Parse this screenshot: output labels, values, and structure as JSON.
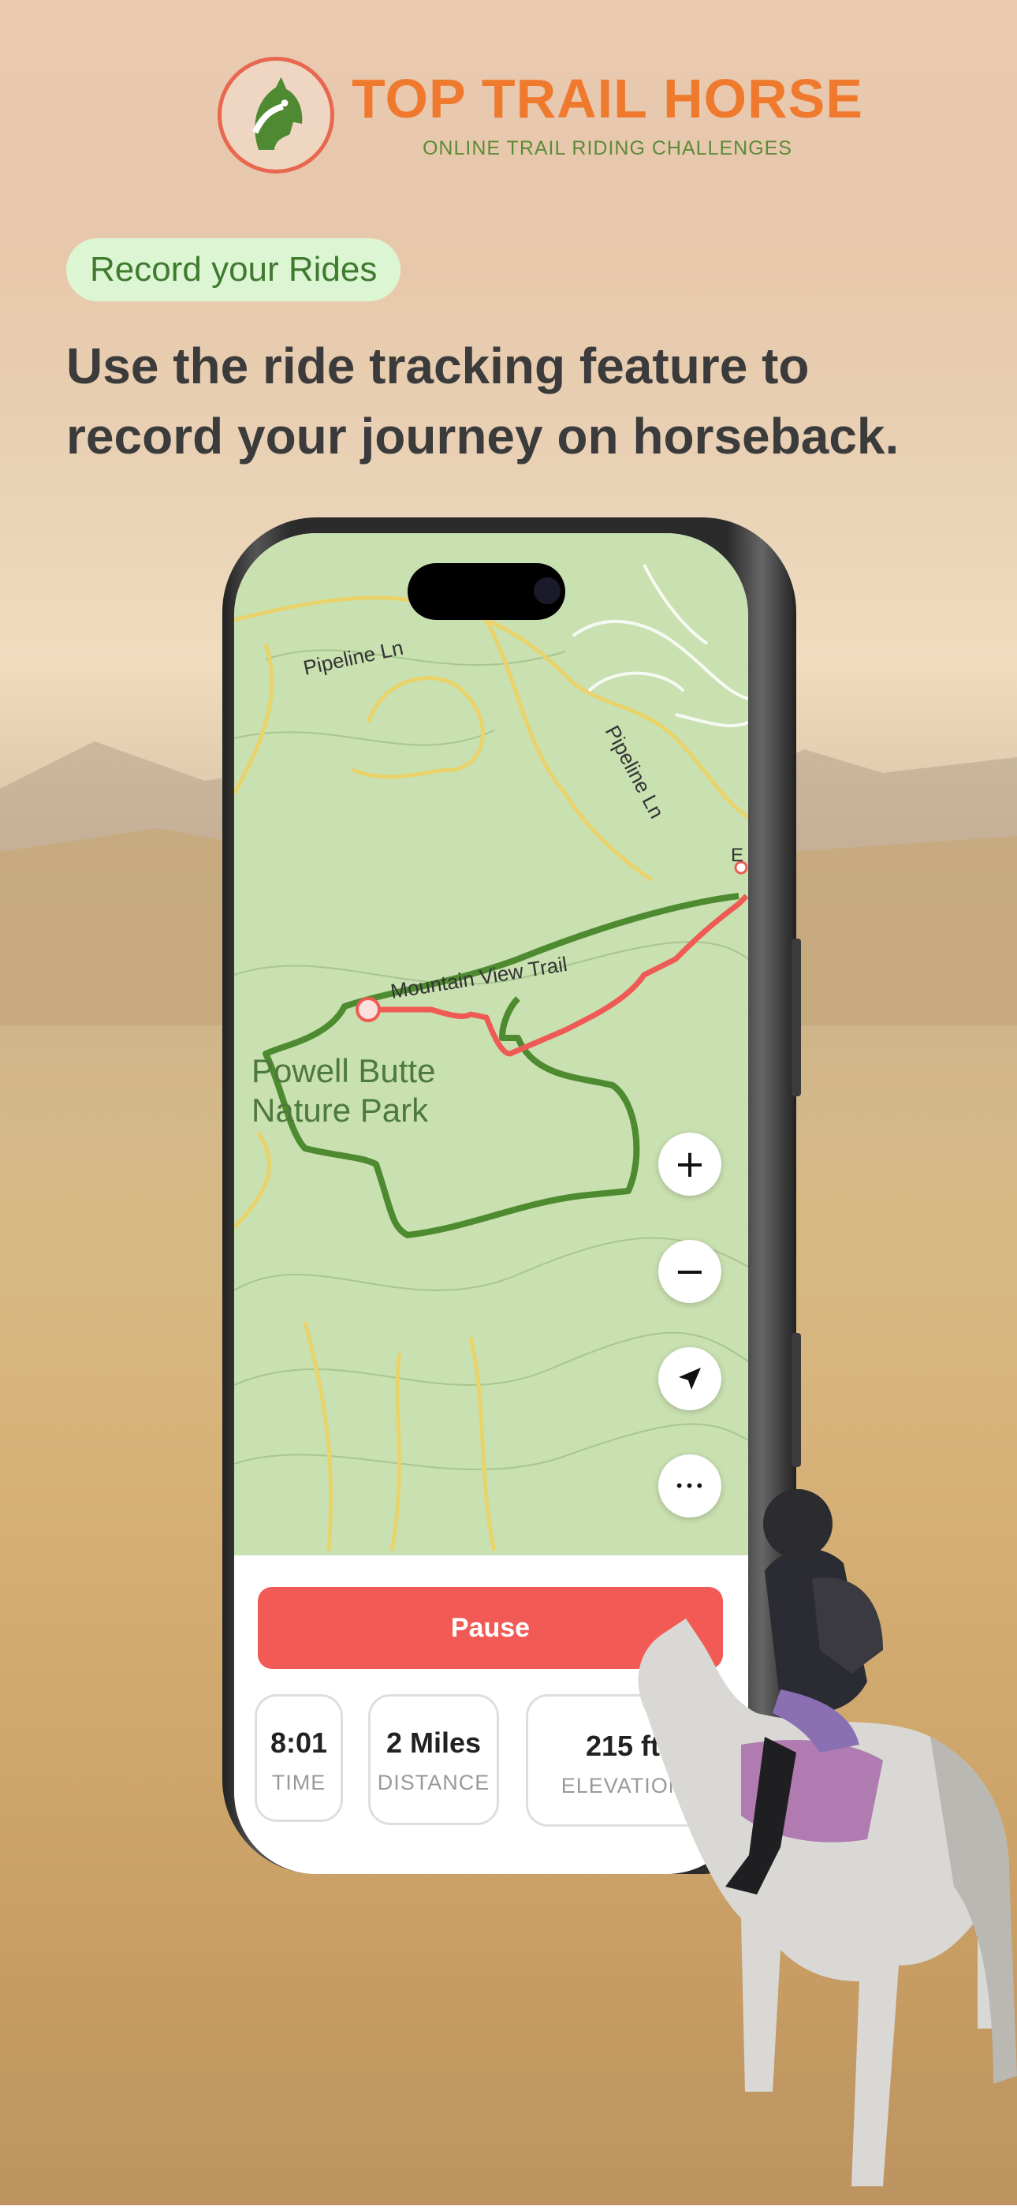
{
  "brand": {
    "title": "TOP TRAIL HORSE",
    "subtitle": "ONLINE TRAIL RIDING CHALLENGES",
    "icon": "horse-head-logo"
  },
  "pill": {
    "label": "Record your Rides"
  },
  "headline": {
    "line1": "Use the ride tracking feature to",
    "line2": "record your journey on horseback."
  },
  "map": {
    "labels": {
      "road1": "Pipeline Ln",
      "road2": "Pipeline Ln",
      "trail": "Mountain View Trail",
      "park1": "Powell Butte",
      "park2": "Nature Park",
      "edge": "E"
    },
    "controls": {
      "zoom_in": "+",
      "zoom_out": "−",
      "locate_icon": "navigation-arrow-icon",
      "more": "•••"
    },
    "colors": {
      "track_green": "#4e8a30",
      "track_red": "#f05a55",
      "map_bg": "#c9e0b0"
    }
  },
  "ride": {
    "pause_label": "Pause",
    "stats": [
      {
        "value": "8:01",
        "label": "TIME"
      },
      {
        "value": "2 Miles",
        "label": "DISTANCE"
      },
      {
        "value": "215 ft",
        "label": "ELEVATION"
      }
    ]
  }
}
